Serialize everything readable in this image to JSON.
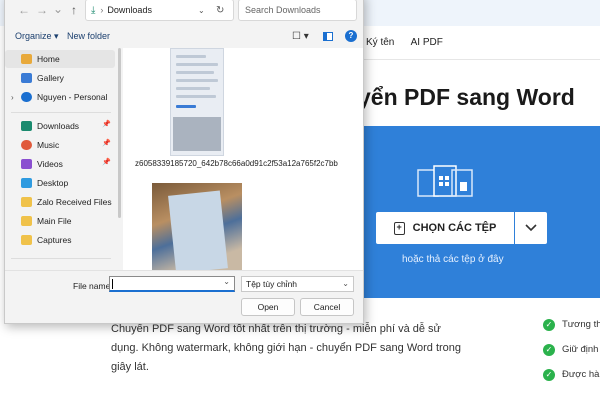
{
  "webpage": {
    "nav": [
      "Ký tên",
      "AI PDF"
    ],
    "hero_title": "yển PDF sang Word",
    "choose_button": "CHỌN CÁC TỆP",
    "drop_hint": "hoặc thả các tệp ở đây",
    "description": "Chuyển PDF sang Word tốt nhất trên thị trường - miễn phí và dễ sử dụng. Không watermark, không giới hạn - chuyển PDF sang Word trong giây lát.",
    "features": [
      "Tương thí",
      "Giữ định c",
      "Được hàn"
    ],
    "colors": {
      "hero_bg": "#2f80d9",
      "check": "#2bb24c"
    }
  },
  "dialog": {
    "address": "Downloads",
    "search_placeholder": "Search Downloads",
    "toolbar": {
      "organize": "Organize ▾",
      "new_folder": "New folder"
    },
    "nav_items": [
      {
        "label": "Home",
        "icon": "home-icon",
        "selected": true
      },
      {
        "label": "Gallery",
        "icon": "gallery-icon"
      },
      {
        "label": "Nguyen - Personal",
        "icon": "onedrive-icon"
      },
      {
        "label": "Downloads",
        "icon": "downloads-icon",
        "pinned": true
      },
      {
        "label": "Music",
        "icon": "music-icon",
        "pinned": true
      },
      {
        "label": "Videos",
        "icon": "videos-icon",
        "pinned": true
      },
      {
        "label": "Desktop",
        "icon": "desktop-icon"
      },
      {
        "label": "Zalo Received Files",
        "icon": "folder-icon"
      },
      {
        "label": "Main File",
        "icon": "folder-icon"
      },
      {
        "label": "Captures",
        "icon": "folder-icon"
      }
    ],
    "files": [
      {
        "name": "z6058339185720_642b78c66a0d91c2f53a12a765f2c7bb"
      }
    ],
    "file_name_label": "File name:",
    "file_name_value": "",
    "file_type": "Tệp tùy chỉnh",
    "open_label": "Open",
    "cancel_label": "Cancel"
  }
}
